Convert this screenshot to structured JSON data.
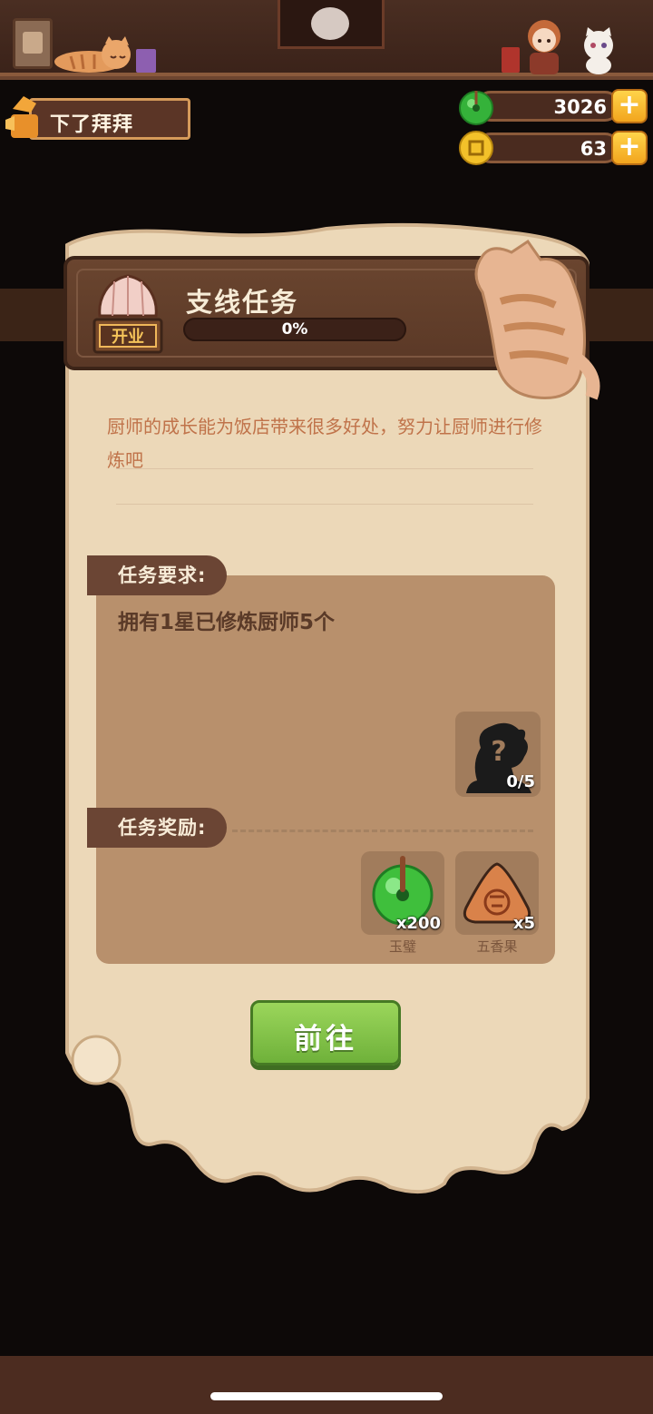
{
  "player": {
    "name": "下了拜拜"
  },
  "currency": {
    "jade": {
      "icon": "jade-disc-icon",
      "value": "3026"
    },
    "coin": {
      "icon": "copper-coin-icon",
      "value": "63"
    },
    "plus_label": "+"
  },
  "task": {
    "icon_label": "开业",
    "title": "支线任务",
    "progress": 0,
    "progress_text": "0%",
    "description": "厨师的成长能为饭店带来很多好处，努力让厨师进行修炼吧",
    "requirement_heading": "任务要求:",
    "requirement_text": "拥有1星已修炼厨师5个",
    "requirement_count": "0/5",
    "reward_heading": "任务奖励:",
    "rewards": [
      {
        "name": "玉璧",
        "count": "x200",
        "icon": "jade-disc-icon"
      },
      {
        "name": "五香果",
        "count": "x5",
        "icon": "five-spice-fruit-icon"
      }
    ],
    "go_button": "前往"
  },
  "colors": {
    "accent_green": "#7cc146",
    "progress_fill": "#f1b84a",
    "parchment": "#ecd8b8"
  }
}
